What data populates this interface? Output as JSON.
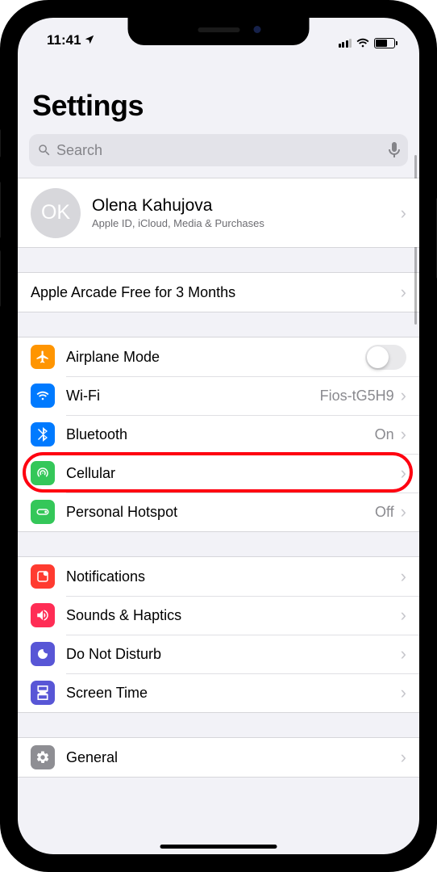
{
  "status": {
    "time": "11:41"
  },
  "title": "Settings",
  "search": {
    "placeholder": "Search"
  },
  "profile": {
    "initials": "OK",
    "name": "Olena Kahujova",
    "subtitle": "Apple ID, iCloud, Media & Purchases"
  },
  "promo": {
    "label": "Apple Arcade Free for 3 Months"
  },
  "network": {
    "airplane": "Airplane Mode",
    "wifi": "Wi-Fi",
    "wifi_value": "Fios-tG5H9",
    "bluetooth": "Bluetooth",
    "bluetooth_value": "On",
    "cellular": "Cellular",
    "hotspot": "Personal Hotspot",
    "hotspot_value": "Off"
  },
  "general": {
    "notifications": "Notifications",
    "sounds": "Sounds & Haptics",
    "dnd": "Do Not Disturb",
    "screentime": "Screen Time"
  },
  "general2": {
    "general": "General"
  }
}
